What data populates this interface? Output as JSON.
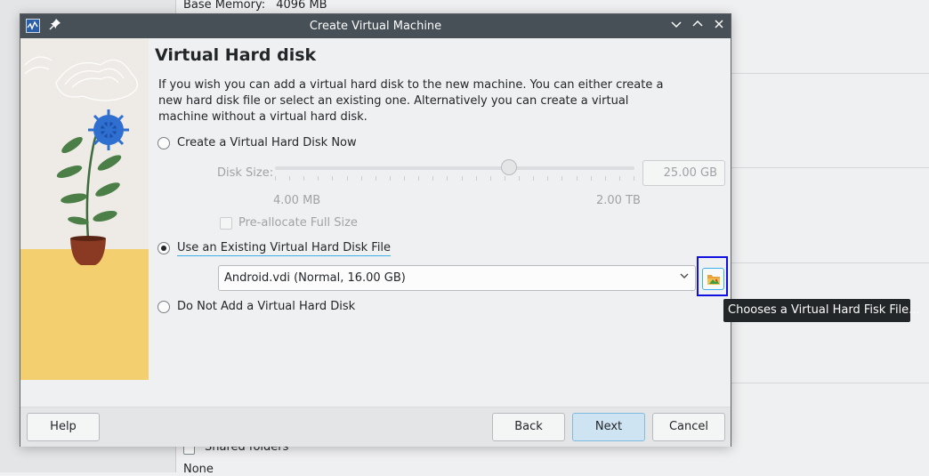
{
  "background": {
    "base_memory_label": "Base Memory:",
    "base_memory_value": "4096 MB",
    "shared_folders_label": "Shared folders",
    "shared_folders_value": "None"
  },
  "window": {
    "title": "Create Virtual Machine"
  },
  "page": {
    "heading": "Virtual Hard disk",
    "description": "If you wish you can add a virtual hard disk to the new machine. You can either create a new hard disk file or select an existing one. Alternatively you can create a virtual machine without a virtual hard disk."
  },
  "options": {
    "create_now": "Create a Virtual Hard Disk Now",
    "use_existing": "Use an Existing Virtual Hard Disk File",
    "do_not_add": "Do Not Add a Virtual Hard Disk",
    "selected": "use_existing"
  },
  "disk_size": {
    "label": "Disk Size:",
    "value": "25.00 GB",
    "min_label": "4.00 MB",
    "max_label": "2.00 TB",
    "slider_fraction": 0.65
  },
  "preallocate": {
    "label": "Pre-allocate Full Size",
    "checked": false
  },
  "existing_disk": {
    "selected": "Android.vdi (Normal, 16.00 GB)"
  },
  "tooltip": "Chooses a Virtual Hard Fisk File...",
  "buttons": {
    "help": "Help",
    "back": "Back",
    "next": "Next",
    "cancel": "Cancel"
  },
  "icons": {
    "app": "virtualbox-icon",
    "pin": "pin-icon",
    "minimize": "chevron-down-icon",
    "maximize": "chevron-up-icon",
    "close": "close-icon",
    "folder": "folder-open-icon",
    "dropdown": "chevron-down-icon"
  }
}
